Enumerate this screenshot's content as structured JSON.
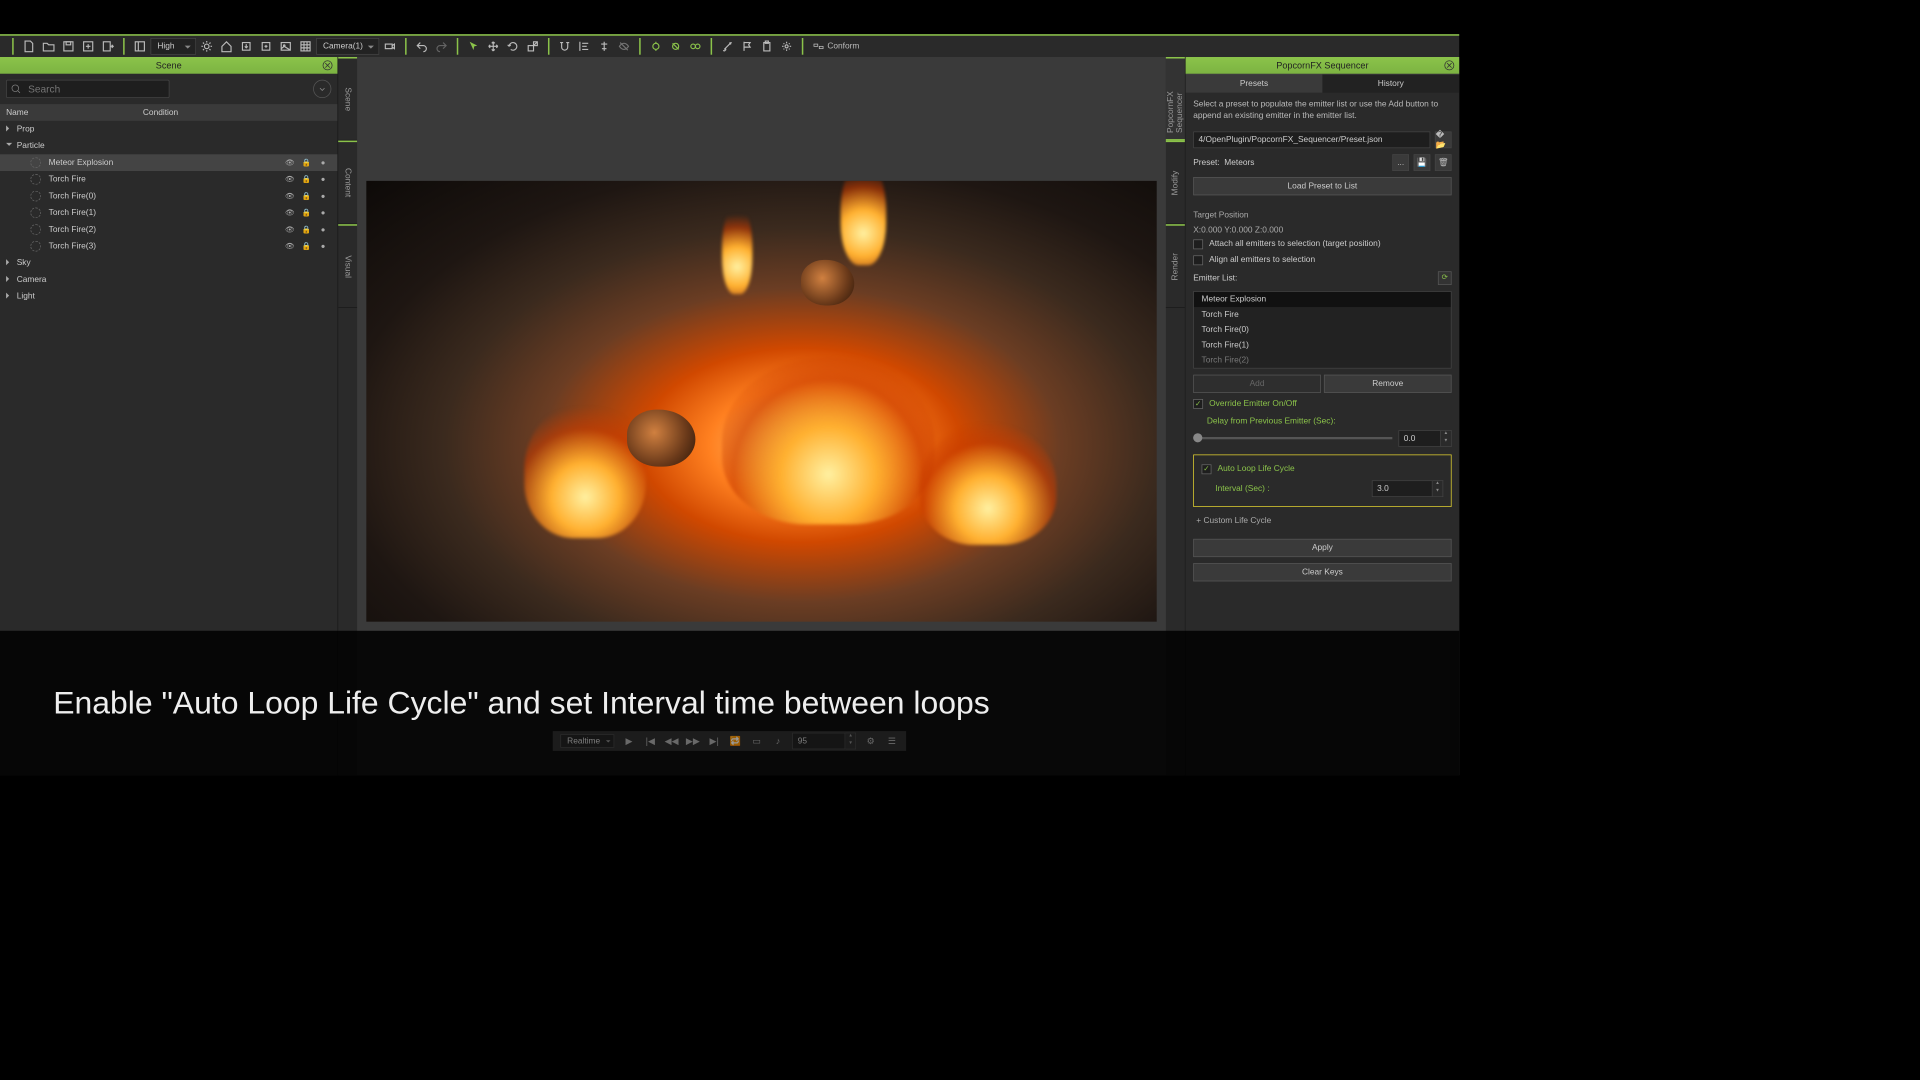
{
  "toolbar": {
    "quality": "High",
    "camera": "Camera(1)",
    "conform": "Conform"
  },
  "scene": {
    "title": "Scene",
    "search_placeholder": "Search",
    "col_name": "Name",
    "col_condition": "Condition",
    "nodes": {
      "prop": "Prop",
      "particle": "Particle",
      "sky": "Sky",
      "camera": "Camera",
      "light": "Light"
    },
    "children": [
      "Meteor Explosion",
      "Torch Fire",
      "Torch Fire(0)",
      "Torch Fire(1)",
      "Torch Fire(2)",
      "Torch Fire(3)"
    ]
  },
  "side_tabs": [
    "Scene",
    "Content",
    "Visual"
  ],
  "right_tabs": [
    "PopcornFX Sequencer",
    "Modify",
    "Render"
  ],
  "sequencer": {
    "title": "PopcornFX Sequencer",
    "tab_presets": "Presets",
    "tab_history": "History",
    "hint": "Select a preset to populate the emitter list or use the Add button to append an existing emitter in the emitter list.",
    "preset_path": "4/OpenPlugin/PopcornFX_Sequencer/Preset.json",
    "preset_label": "Preset:",
    "preset_value": "Meteors",
    "load_btn": "Load Preset to List",
    "target_label": "Target Position",
    "target_coords": "X:0.000   Y:0.000   Z:0.000",
    "attach": "Attach all emitters to selection (target position)",
    "align": "Align all emitters to selection",
    "emitter_list_label": "Emitter List:",
    "emitters": [
      "Meteor Explosion",
      "Torch Fire",
      "Torch Fire(0)",
      "Torch Fire(1)",
      "Torch Fire(2)"
    ],
    "add": "Add",
    "remove": "Remove",
    "override": "Override Emitter On/Off",
    "delay_label": "Delay from Previous Emitter (Sec):",
    "delay_value": "0.0",
    "autoloop": "Auto Loop Life Cycle",
    "interval_label": "Interval (Sec) :",
    "interval_value": "3.0",
    "custom": "Custom Life Cycle",
    "apply": "Apply",
    "clear": "Clear Keys"
  },
  "playbar": {
    "mode": "Realtime",
    "frame": "95"
  },
  "caption": "Enable \"Auto Loop Life Cycle\" and set Interval time between loops"
}
